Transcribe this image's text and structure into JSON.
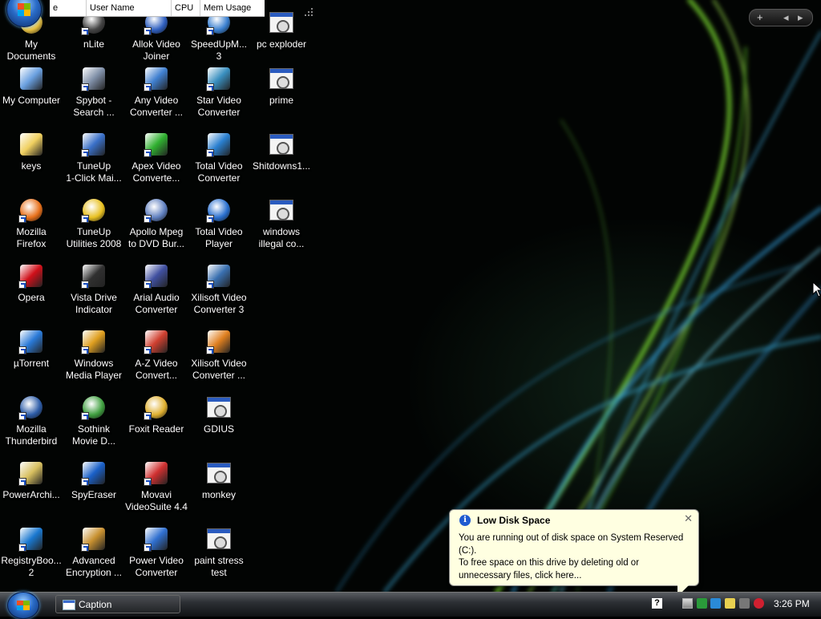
{
  "taskmanager": {
    "cols": [
      "e",
      "User Name",
      "CPU",
      "Mem Usage"
    ]
  },
  "icons": [
    {
      "label": "My\nDocuments",
      "icon": "folder-documents-icon",
      "col": 0,
      "row": 0,
      "color": "#e8c040"
    },
    {
      "label": "My Computer",
      "icon": "computer-icon",
      "col": 0,
      "row": 1,
      "color": "#6aa0e0"
    },
    {
      "label": "keys",
      "icon": "folder-icon",
      "col": 0,
      "row": 2,
      "color": "#f0d060"
    },
    {
      "label": "Mozilla\nFirefox",
      "icon": "firefox-icon",
      "col": 0,
      "row": 3,
      "color": "#e8701a",
      "shortcut": true
    },
    {
      "label": "Opera",
      "icon": "opera-icon",
      "col": 0,
      "row": 4,
      "color": "#d0101a",
      "shortcut": true
    },
    {
      "label": "µTorrent",
      "icon": "utorrent-icon",
      "col": 0,
      "row": 5,
      "color": "#2a7ad8",
      "shortcut": true
    },
    {
      "label": "Mozilla\nThunderbird",
      "icon": "thunderbird-icon",
      "col": 0,
      "row": 6,
      "color": "#2e5da8",
      "shortcut": true
    },
    {
      "label": "PowerArchi...",
      "icon": "powerarchiver-icon",
      "col": 0,
      "row": 7,
      "color": "#d8c060",
      "shortcut": true
    },
    {
      "label": "RegistryBoo...\n2",
      "icon": "registrybooster-icon",
      "col": 0,
      "row": 8,
      "color": "#1a78d0",
      "shortcut": true
    },
    {
      "label": "nLite",
      "icon": "nlite-icon",
      "col": 1,
      "row": 0,
      "color": "#444444",
      "shortcut": true
    },
    {
      "label": "Spybot -\nSearch ...",
      "icon": "spybot-icon",
      "col": 1,
      "row": 1,
      "color": "#8090a8",
      "shortcut": true
    },
    {
      "label": "TuneUp\n1-Click Mai...",
      "icon": "tuneup-maintenance-icon",
      "col": 1,
      "row": 2,
      "color": "#3a70c8",
      "shortcut": true
    },
    {
      "label": "TuneUp\nUtilities 2008",
      "icon": "tuneup-utilities-icon",
      "col": 1,
      "row": 3,
      "color": "#e8c020",
      "shortcut": true
    },
    {
      "label": "Vista Drive\nIndicator",
      "icon": "drive-indicator-icon",
      "col": 1,
      "row": 4,
      "color": "#303030",
      "shortcut": true
    },
    {
      "label": "Windows\nMedia Player",
      "icon": "media-player-icon",
      "col": 1,
      "row": 5,
      "color": "#e0a020",
      "shortcut": true
    },
    {
      "label": "Sothink\nMovie D...",
      "icon": "sothink-icon",
      "col": 1,
      "row": 6,
      "color": "#40a040",
      "shortcut": true
    },
    {
      "label": "SpyEraser",
      "icon": "spyeraser-icon",
      "col": 1,
      "row": 7,
      "color": "#1a60c8",
      "shortcut": true
    },
    {
      "label": "Advanced\nEncryption ...",
      "icon": "encryption-icon",
      "col": 1,
      "row": 8,
      "color": "#c89030",
      "shortcut": true
    },
    {
      "label": "Allok Video\nJoiner",
      "icon": "allok-video-joiner-icon",
      "col": 2,
      "row": 0,
      "color": "#3060c0",
      "shortcut": true
    },
    {
      "label": "Any Video\nConverter ...",
      "icon": "any-video-converter-icon",
      "col": 2,
      "row": 1,
      "color": "#4080d0",
      "shortcut": true
    },
    {
      "label": "Apex Video\nConverte...",
      "icon": "apex-video-converter-icon",
      "col": 2,
      "row": 2,
      "color": "#30b030",
      "shortcut": true
    },
    {
      "label": "Apollo Mpeg\nto DVD Bur...",
      "icon": "apollo-icon",
      "col": 2,
      "row": 3,
      "color": "#6080c0",
      "shortcut": true
    },
    {
      "label": "Arial Audio\nConverter",
      "icon": "arial-audio-icon",
      "col": 2,
      "row": 4,
      "color": "#4050a0",
      "shortcut": true
    },
    {
      "label": "A-Z Video\nConvert...",
      "icon": "az-video-icon",
      "col": 2,
      "row": 5,
      "color": "#d04030",
      "shortcut": true
    },
    {
      "label": "Foxit Reader",
      "icon": "foxit-reader-icon",
      "col": 2,
      "row": 6,
      "color": "#e0b030",
      "shortcut": true
    },
    {
      "label": "Movavi\nVideoSuite 4.4",
      "icon": "movavi-icon",
      "col": 2,
      "row": 7,
      "color": "#d03030",
      "shortcut": true
    },
    {
      "label": "Power Video\nConverter",
      "icon": "power-video-icon",
      "col": 2,
      "row": 8,
      "color": "#3070d0",
      "shortcut": true
    },
    {
      "label": "SpeedUpM...\n3",
      "icon": "speedup-icon",
      "col": 3,
      "row": 0,
      "color": "#3a80d0",
      "shortcut": true
    },
    {
      "label": "Star Video\nConverter",
      "icon": "star-video-icon",
      "col": 3,
      "row": 1,
      "color": "#3a90c0",
      "shortcut": true
    },
    {
      "label": "Total Video\nConverter",
      "icon": "total-video-converter-icon",
      "col": 3,
      "row": 2,
      "color": "#2a80d0",
      "shortcut": true
    },
    {
      "label": "Total Video\nPlayer",
      "icon": "total-video-player-icon",
      "col": 3,
      "row": 3,
      "color": "#2a70d0",
      "shortcut": true
    },
    {
      "label": "Xilisoft Video\nConverter 3",
      "icon": "xilisoft-icon",
      "col": 3,
      "row": 4,
      "color": "#3a70b0",
      "shortcut": true
    },
    {
      "label": "Xilisoft Video\nConverter ...",
      "icon": "xilisoft-2-icon",
      "col": 3,
      "row": 5,
      "color": "#e08020",
      "shortcut": true
    },
    {
      "label": "GDIUS",
      "icon": "application-window-icon",
      "col": 3,
      "row": 6,
      "color": "#2a5bbf",
      "window": true
    },
    {
      "label": "monkey",
      "icon": "application-window-icon",
      "col": 3,
      "row": 7,
      "color": "#2a5bbf",
      "window": true
    },
    {
      "label": "paint stress\ntest",
      "icon": "application-window-icon",
      "col": 3,
      "row": 8,
      "color": "#2a5bbf",
      "window": true
    },
    {
      "label": "pc exploder",
      "icon": "application-window-icon",
      "col": 4,
      "row": 0,
      "color": "#2a5bbf",
      "window": true
    },
    {
      "label": "prime",
      "icon": "application-window-icon",
      "col": 4,
      "row": 1,
      "color": "#2a5bbf",
      "window": true
    },
    {
      "label": "Shitdowns1...",
      "icon": "application-window-icon",
      "col": 4,
      "row": 2,
      "color": "#2a5bbf",
      "window": true
    },
    {
      "label": "windows\nillegal co...",
      "icon": "application-window-icon",
      "col": 4,
      "row": 3,
      "color": "#2a5bbf",
      "window": true
    }
  ],
  "sidebar": {
    "add": "+",
    "prev": "◂",
    "next": "▸"
  },
  "balloon": {
    "title": "Low Disk Space",
    "info_glyph": "i",
    "close_glyph": "✕",
    "line1": "You are running out of disk space on System Reserved (C:).",
    "line2": "To free space on this drive by deleting old or unnecessary files, click here..."
  },
  "taskbar": {
    "button_label": "Caption",
    "clock": "3:26 PM",
    "help_glyph": "?"
  }
}
